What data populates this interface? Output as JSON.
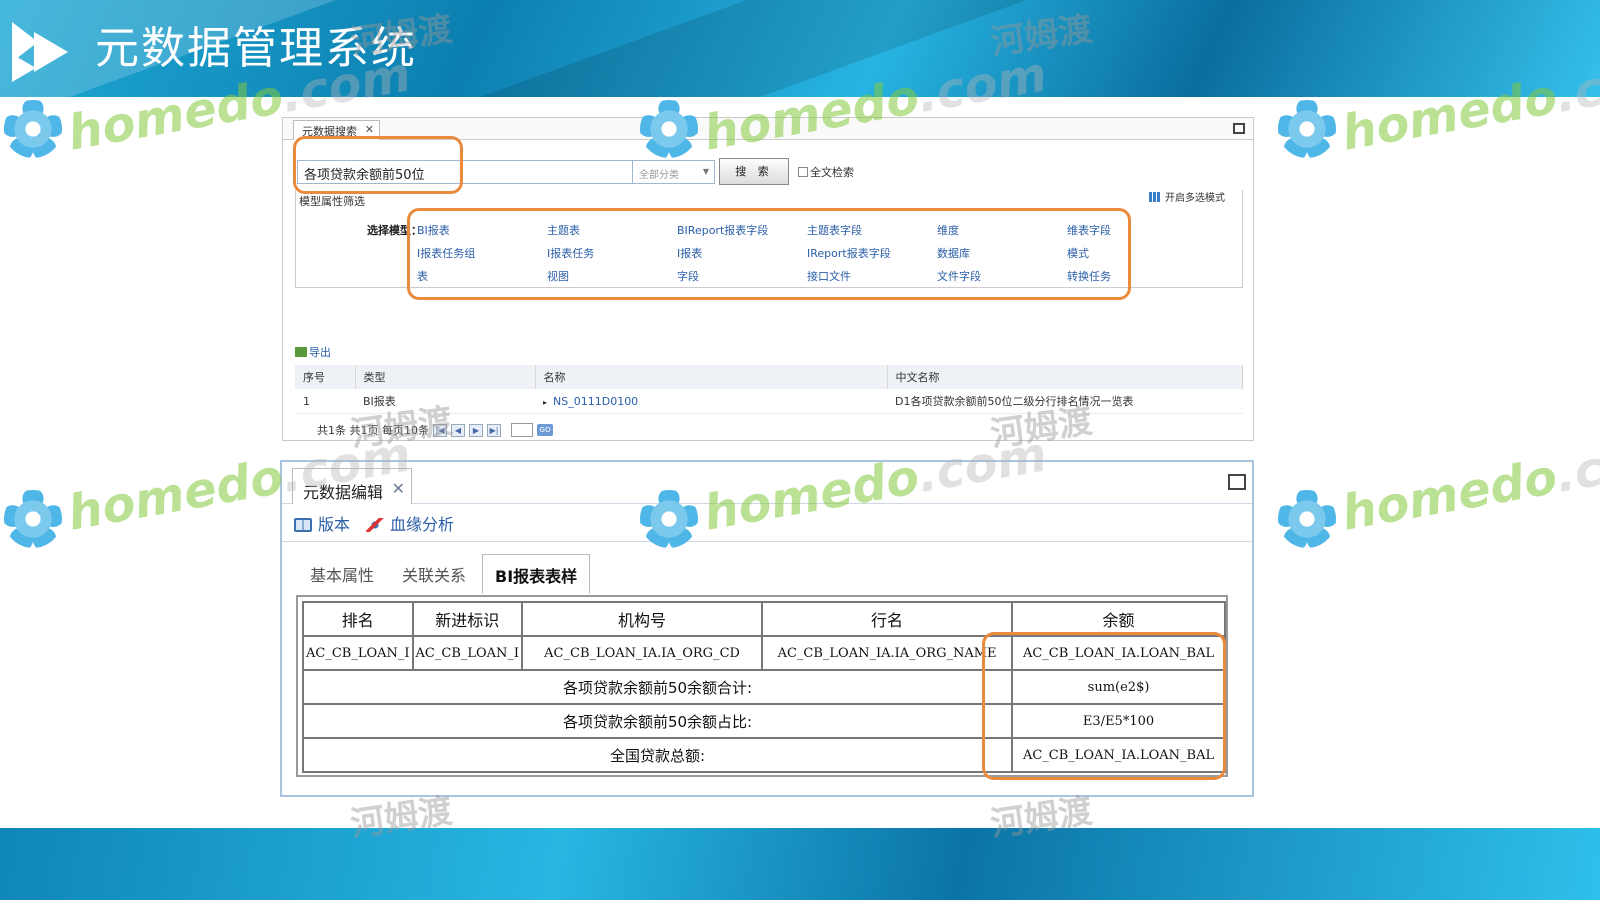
{
  "app": {
    "title": "元数据管理系统"
  },
  "watermarks": {
    "cn": "河姆渡",
    "logo": "homedo",
    "domain": ".com"
  },
  "search_panel": {
    "tab_label": "元数据搜索",
    "search_value": "各项贷款余额前50位",
    "category": "全部分类",
    "search_button": "搜 索",
    "fulltext_label": "全文检索",
    "multi_select": "开启多选模式",
    "filter_title": "模型属性筛选",
    "select_model_label": "选择模型：",
    "models": [
      "BI报表",
      "主题表",
      "BIReport报表字段",
      "主题表字段",
      "维度",
      "维表字段",
      "I报表任务组",
      "I报表任务",
      "I报表",
      "IReport报表字段",
      "数据库",
      "模式",
      "表",
      "视图",
      "字段",
      "接口文件",
      "文件字段",
      "转换任务"
    ],
    "export_label": "导出",
    "table": {
      "headers": [
        "序号",
        "类型",
        "名称",
        "中文名称"
      ],
      "rows": [
        [
          "1",
          "BI报表",
          "NS_0111D0100",
          "D1各项贷款余额前50位二级分行排名情况一览表"
        ]
      ]
    },
    "pager_text": "共1条 共1页 每页10条"
  },
  "edit_panel": {
    "tab_label": "元数据编辑",
    "toolbar": {
      "version": "版本",
      "lineage": "血缘分析"
    },
    "subtabs": [
      "基本属性",
      "关联关系",
      "BI报表表样"
    ],
    "bi_table": {
      "headers": [
        "排名",
        "新进标识",
        "机构号",
        "行名",
        "余额"
      ],
      "row1": [
        "AC_CB_LOAN_I",
        "AC_CB_LOAN_I",
        "AC_CB_LOAN_IA.IA_ORG_CD",
        "AC_CB_LOAN_IA.IA_ORG_NAME",
        "AC_CB_LOAN_IA.LOAN_BAL"
      ],
      "sum_label": "各项贷款余额前50余额合计:",
      "sum_value": "sum(e2$)",
      "ratio_label": "各项贷款余额前50余额占比:",
      "ratio_value": "E3/E5*100",
      "total_label": "全国贷款总额:",
      "total_value": "AC_CB_LOAN_IA.LOAN_BAL"
    }
  },
  "colors": {
    "highlight": "#e98a3d",
    "link": "#2a5ea8",
    "banner": "#1fa9d6"
  }
}
